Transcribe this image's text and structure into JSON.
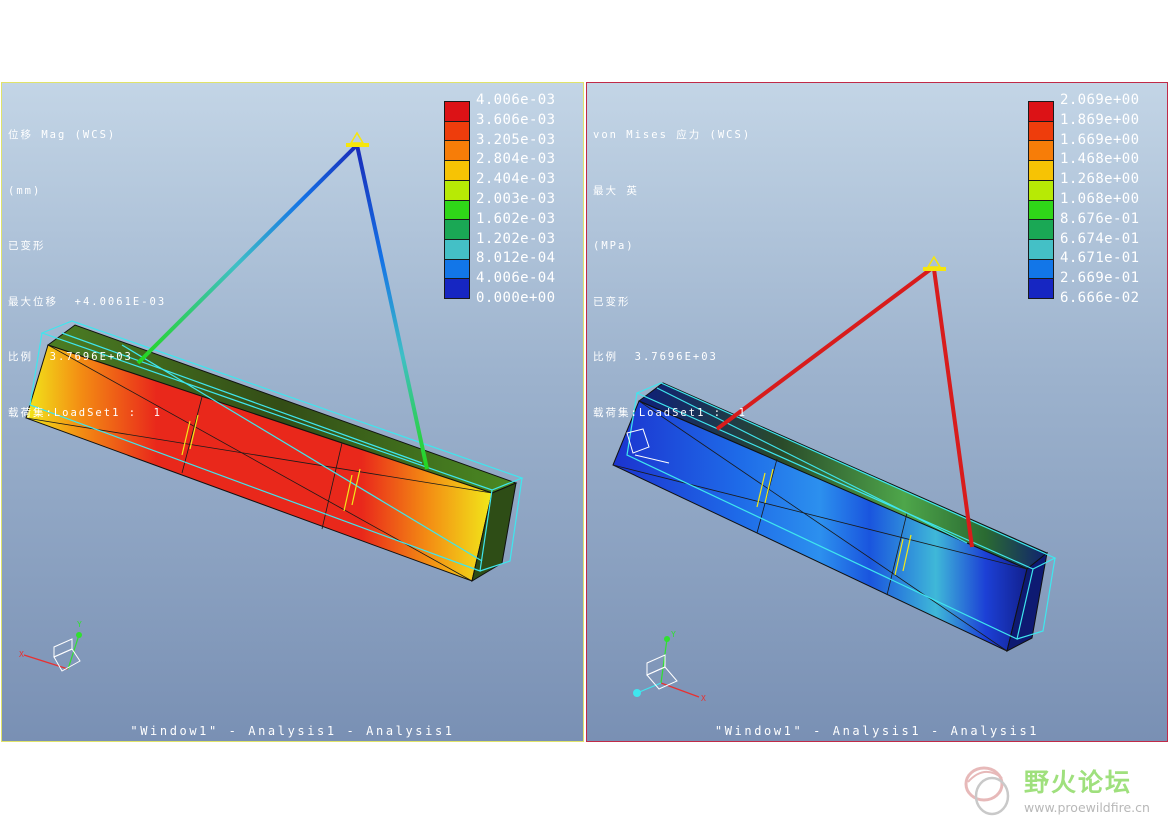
{
  "left_window": {
    "info_lines": [
      "位移 Mag (WCS)",
      "(mm)",
      "已变形",
      "最大位移  +4.0061E-03",
      "比例  3.7696E+03",
      "载荷集:LoadSet1 :  1"
    ],
    "legend_values": [
      "4.006e-03",
      "3.606e-03",
      "3.205e-03",
      "2.804e-03",
      "2.404e-03",
      "2.003e-03",
      "1.602e-03",
      "1.202e-03",
      "8.012e-04",
      "4.006e-04",
      "0.000e+00"
    ],
    "legend_colors": [
      "#dc1216",
      "#ee3d0c",
      "#f77d08",
      "#f7c304",
      "#b7ea05",
      "#2fd718",
      "#1aa855",
      "#44c0c6",
      "#1276e8",
      "#1626c2"
    ],
    "window_title": "\"Window1\" - Analysis1 - Analysis1",
    "axis_labels": {
      "y": "Y",
      "x": "X",
      "z": "Z"
    }
  },
  "right_window": {
    "info_lines": [
      "von Mises 应力 (WCS)",
      "最大 英",
      "(MPa)",
      "已变形",
      "比例  3.7696E+03",
      "载荷集:LoadSet1 :  1"
    ],
    "legend_values": [
      "2.069e+00",
      "1.869e+00",
      "1.669e+00",
      "1.468e+00",
      "1.268e+00",
      "1.068e+00",
      "8.676e-01",
      "6.674e-01",
      "4.671e-01",
      "2.669e-01",
      "6.666e-02"
    ],
    "legend_colors": [
      "#dc1216",
      "#ee3d0c",
      "#f77d08",
      "#f7c304",
      "#b7ea05",
      "#2fd718",
      "#1aa855",
      "#44c0c6",
      "#1276e8",
      "#1626c2"
    ],
    "window_title": "\"Window1\" - Analysis1 - Analysis1",
    "axis_labels": {
      "y": "Y",
      "x": "X",
      "z": "Z"
    }
  },
  "watermark": {
    "name": "野火论坛",
    "url": "www.proewildfire.cn"
  }
}
